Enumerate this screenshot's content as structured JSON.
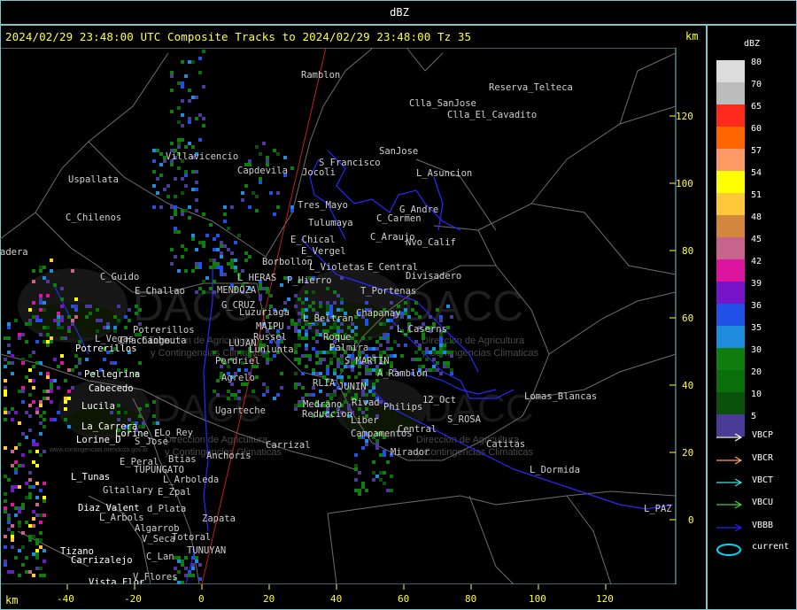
{
  "title": "dBZ",
  "header": "2024/02/29 23:48:00 UTC Composite Tracks to 2024/02/29 23:48:00 Tz 35",
  "km_unit_top": "km",
  "km_unit_bottom": "km",
  "x_ticks": [
    "-40",
    "-20",
    "0",
    "20",
    "40",
    "60",
    "80",
    "100",
    "120"
  ],
  "y_ticks": [
    "120",
    "100",
    "80",
    "60",
    "40",
    "20",
    "0"
  ],
  "legend": {
    "title": "dBZ",
    "levels": [
      {
        "label": "80",
        "color": "#dcdcdc"
      },
      {
        "label": "70",
        "color": "#bcbcbc"
      },
      {
        "label": "65",
        "color": "#ff2a1e"
      },
      {
        "label": "60",
        "color": "#ff6600"
      },
      {
        "label": "57",
        "color": "#ff9966"
      },
      {
        "label": "54",
        "color": "#ffff00"
      },
      {
        "label": "51",
        "color": "#ffc838"
      },
      {
        "label": "48",
        "color": "#d2873c"
      },
      {
        "label": "45",
        "color": "#c8648c"
      },
      {
        "label": "42",
        "color": "#dc14a0"
      },
      {
        "label": "39",
        "color": "#7814c8"
      },
      {
        "label": "36",
        "color": "#2050e6"
      },
      {
        "label": "35",
        "color": "#1e8cdc"
      },
      {
        "label": "30",
        "color": "#0f7d0f"
      },
      {
        "label": "20",
        "color": "#0a6e0a"
      },
      {
        "label": "10",
        "color": "#0a500a"
      },
      {
        "label": "5",
        "color": "#4a3c96"
      }
    ],
    "tracks": [
      {
        "label": "VBCP",
        "color": "#ffffff",
        "shape": "arrow"
      },
      {
        "label": "VBCR",
        "color": "#ff9a6a",
        "shape": "arrow"
      },
      {
        "label": "VBCT",
        "color": "#40e0e0",
        "shape": "arrow"
      },
      {
        "label": "VBCU",
        "color": "#40d040",
        "shape": "arrow"
      },
      {
        "label": "VBBB",
        "color": "#2020ff",
        "shape": "arrow"
      },
      {
        "label": "current",
        "color": "#00d8ff",
        "shape": "ellipse"
      }
    ]
  },
  "places_gray": [
    "Ramblon",
    "Reserva_Telteca",
    "Clla_SanJose",
    "Clla_El_Cavadito",
    "SanJose",
    "S_Francisco",
    "Jocoli",
    "L_Asuncion",
    "Villavicencio",
    "Capdevila",
    "Uspallata",
    "Tres_Mayo",
    "G_Andre",
    "C_Carmen",
    "C_Chilenos",
    "Tulumaya",
    "E_Chical",
    "C_Araujo",
    "Nvo_Calif",
    "E_Vergel",
    "Borbollon",
    "L_Violetas",
    "E_Central",
    "Divisadero",
    "adera",
    "C_Guido",
    "L_HERAS",
    "P_Hierro",
    "E_Challao",
    "MENDOZA",
    "T_Portenas",
    "G_CRUZ",
    "Luzuriaga",
    "Chapanay",
    "L_Beltran",
    "MAIPU",
    "Potrerillos",
    "Chachingo",
    "L_Vegas",
    "Russel",
    "Cacheuta",
    "Palmira",
    "Roque",
    "L_Caserns",
    "LUJAN",
    "Lunlunta",
    "Perdriel",
    "S_MARTIN",
    "A_Ramblon",
    "Agrelo",
    "RLIA",
    "JUNIN",
    "Lomas_Blancas",
    "12_Oct",
    "Ugarteche",
    "Medrano",
    "Rivad",
    "Reduccion",
    "Philips",
    "S_ROSA",
    "Liber",
    "Central",
    "Campamentos",
    "Carrizal",
    "Catitas",
    "Mirador",
    "Anchoris",
    "L_Dormida",
    "Zapata",
    "L_PAZ",
    "E_Peral",
    "Btias",
    "L_Arboleda",
    "E_Zpal",
    "Gltallary",
    "d_Plata",
    "TUPUNGATO",
    "L_Arbols",
    "Algarrob",
    "V_Seca",
    "Totoral",
    "TUNUYAN",
    "C_Lan",
    "V_Flores",
    "Lo_Rey",
    "S_Jose"
  ],
  "places_white": [
    "Potrerillos",
    "Pellegrina",
    "Cabecedo",
    "Lucila",
    "La_Carrera",
    "Lorine_D",
    "Lorine_E",
    "L_Tunas",
    "Diaz_Valent",
    "Carrizalejo",
    "Vista_Flor",
    "Tizano"
  ],
  "watermark": {
    "brand": "DACC",
    "line1": "Direccion de Agricultura",
    "line2": "y Contingencias Climaticas",
    "url": "www.contingencias.mendoza.gov.ar"
  }
}
